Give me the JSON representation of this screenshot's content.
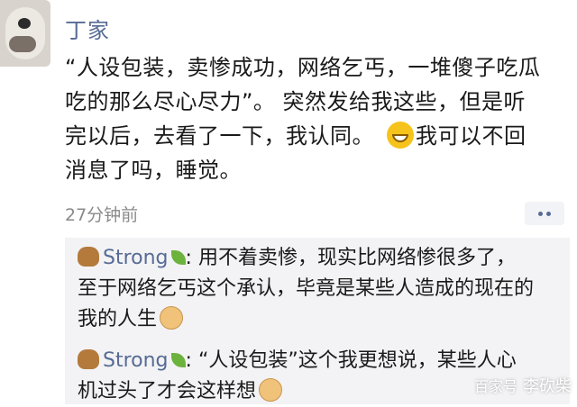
{
  "post": {
    "author": "丁家",
    "lines": [
      "“人设包装，卖惨成功，网络乞丐，一堆傻子吃瓜",
      "吃的那么尽心尽力”。 突然发给我这些，但是听",
      "完以后，去看了一下，我认同。",
      "我可以不回",
      "消息了吗，睡觉。"
    ],
    "time": "27分钟前",
    "avatar_icon": "panda-avatar",
    "emoji_icon": "grin-emoji-icon"
  },
  "comments": [
    {
      "name": "Strong",
      "separator": ":",
      "lines": [
        " 用不着卖惨，现实比网络惨很多了，",
        "至于网络乞丐这个承认，毕竟是某些人造成的现在的",
        "我的人生"
      ]
    },
    {
      "name": "Strong",
      "separator": ":",
      "lines": [
        " “人设包装”这个我更想说，某些人心",
        "机过头了才会这样想"
      ]
    }
  ],
  "watermark": {
    "left": "百家号",
    "right": "李砍柴"
  },
  "colors": {
    "link": "#576b95",
    "comment_bg": "#f3f3f5",
    "time": "#8a8a8a"
  }
}
